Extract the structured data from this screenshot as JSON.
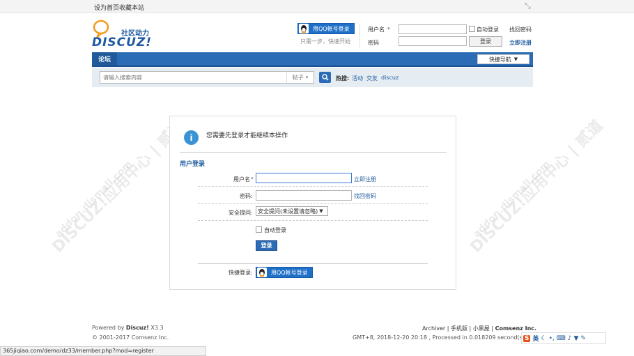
{
  "topbar": {
    "set_home": "设为首页",
    "bookmark": "收藏本站"
  },
  "logo": {
    "slogan": "社区动力",
    "brand": "DISCUZ!"
  },
  "header": {
    "qq_login": "用QQ帐号登录",
    "qq_hint": "只需一步，快速开始",
    "username_label": "用户名",
    "password_label": "密码",
    "auto_login": "自动登录",
    "find_password": "找回密码",
    "login_button": "登录",
    "register_link": "立即注册"
  },
  "nav": {
    "forum": "论坛",
    "quick_nav": "快捷导航"
  },
  "search": {
    "placeholder": "请输入搜索内容",
    "scope": "帖子",
    "hot_label": "热搜:",
    "hot": [
      "活动",
      "交友",
      "discuz"
    ]
  },
  "login_box": {
    "message": "您需要先登录才能继续本操作",
    "section_title": "用户登录",
    "username_label": "用户名",
    "register_link": "立即注册",
    "password_label": "密码:",
    "find_password": "找回密码",
    "question_label": "安全提问:",
    "question_value": "安全提问(未设置请忽略)",
    "auto_login": "自动登录",
    "login_button": "登录",
    "quick_login_label": "快捷登录:",
    "qq_login": "用QQ帐号登录"
  },
  "watermark": {
    "text": "DISCUZ!应用中心 | 贰道",
    "url": "addon.dismall.com"
  },
  "footer": {
    "powered_by": "Powered by",
    "product": "Discuz!",
    "version": "X3.3",
    "copyright": "© 2001-2017 Comsenz Inc.",
    "links": [
      "Archiver",
      "手机版",
      "小黑屋",
      "Comsenz Inc."
    ],
    "stats": "GMT+8, 2018-12-20 20:18 , Processed in 0.018209 second(s), 5 que"
  },
  "statusbar": {
    "url": "365jiqiao.com/demo/dz33/member.php?mod=register"
  },
  "ime": {
    "logo": "S",
    "lang": "英"
  },
  "colors": {
    "accent": "#2c6cb6",
    "link": "#1f5b9f",
    "brand_orange": "#f29b1d"
  }
}
